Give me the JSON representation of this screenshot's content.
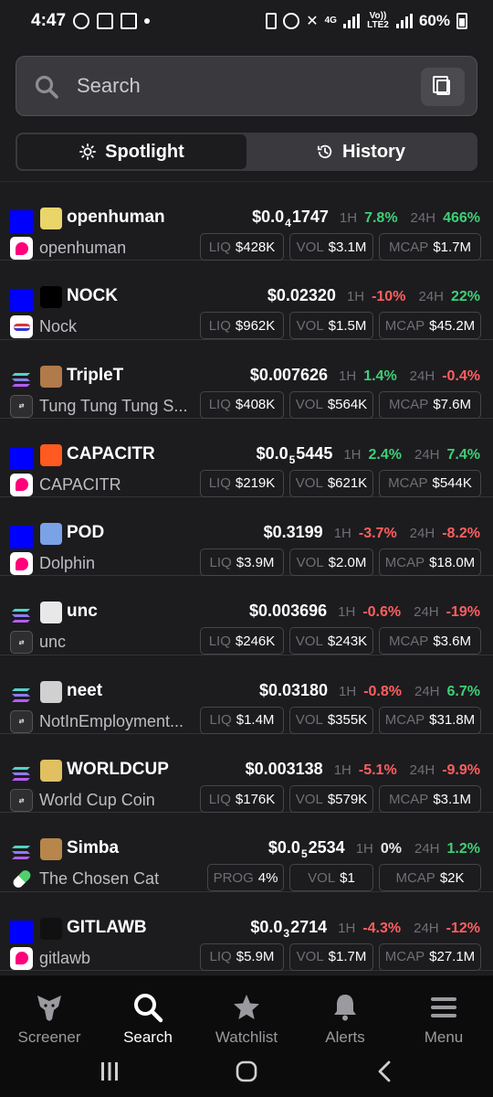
{
  "status_bar": {
    "time": "4:47",
    "network_4g": "4G",
    "volte": "Vo)) LTE2",
    "battery": "60%"
  },
  "search": {
    "placeholder": "Search",
    "value": ""
  },
  "tabs": [
    {
      "label": "Spotlight",
      "icon": "sun-icon",
      "active": true
    },
    {
      "label": "History",
      "icon": "history-icon",
      "active": false
    }
  ],
  "labels": {
    "h1": "1H",
    "h24": "24H",
    "liq": "LIQ",
    "vol": "VOL",
    "mcap": "MCAP",
    "prog": "PROG"
  },
  "tokens": [
    {
      "symbol": "openhuman",
      "name": "openhuman",
      "chain": "blue",
      "dex": "uniswap",
      "price_pre": "$0.0",
      "price_sub": "4",
      "price_post": "1747",
      "h1": "7.8%",
      "h1_dir": "pos",
      "h24": "466%",
      "h24_dir": "pos",
      "liq": "$428K",
      "vol": "$3.1M",
      "mcap": "$1.7M"
    },
    {
      "symbol": "NOCK",
      "name": "Nock",
      "chain": "blue",
      "dex": "nock",
      "price_pre": "$0.02320",
      "price_sub": "",
      "price_post": "",
      "h1": "-10%",
      "h1_dir": "neg",
      "h24": "22%",
      "h24_dir": "pos",
      "liq": "$962K",
      "vol": "$1.5M",
      "mcap": "$45.2M"
    },
    {
      "symbol": "TripleT",
      "name": "Tung Tung Tung S...",
      "chain": "solana",
      "dex": "swap",
      "price_pre": "$0.007626",
      "price_sub": "",
      "price_post": "",
      "h1": "1.4%",
      "h1_dir": "pos",
      "h24": "-0.4%",
      "h24_dir": "neg",
      "liq": "$408K",
      "vol": "$564K",
      "mcap": "$7.6M"
    },
    {
      "symbol": "CAPACITR",
      "name": "CAPACITR",
      "chain": "blue",
      "dex": "uniswap",
      "price_pre": "$0.0",
      "price_sub": "5",
      "price_post": "5445",
      "h1": "2.4%",
      "h1_dir": "pos",
      "h24": "7.4%",
      "h24_dir": "pos",
      "liq": "$219K",
      "vol": "$621K",
      "mcap": "$544K"
    },
    {
      "symbol": "POD",
      "name": "Dolphin",
      "chain": "blue",
      "dex": "uniswap",
      "price_pre": "$0.3199",
      "price_sub": "",
      "price_post": "",
      "h1": "-3.7%",
      "h1_dir": "neg",
      "h24": "-8.2%",
      "h24_dir": "neg",
      "liq": "$3.9M",
      "vol": "$2.0M",
      "mcap": "$18.0M"
    },
    {
      "symbol": "unc",
      "name": "unc",
      "chain": "solana",
      "dex": "swap",
      "price_pre": "$0.003696",
      "price_sub": "",
      "price_post": "",
      "h1": "-0.6%",
      "h1_dir": "neg",
      "h24": "-19%",
      "h24_dir": "neg",
      "liq": "$246K",
      "vol": "$243K",
      "mcap": "$3.6M"
    },
    {
      "symbol": "neet",
      "name": "NotInEmployment...",
      "chain": "solana",
      "dex": "swap",
      "price_pre": "$0.03180",
      "price_sub": "",
      "price_post": "",
      "h1": "-0.8%",
      "h1_dir": "neg",
      "h24": "6.7%",
      "h24_dir": "pos",
      "liq": "$1.4M",
      "vol": "$355K",
      "mcap": "$31.8M"
    },
    {
      "symbol": "WORLDCUP",
      "name": "World Cup Coin",
      "chain": "solana",
      "dex": "swap",
      "price_pre": "$0.003138",
      "price_sub": "",
      "price_post": "",
      "h1": "-5.1%",
      "h1_dir": "neg",
      "h24": "-9.9%",
      "h24_dir": "neg",
      "liq": "$176K",
      "vol": "$579K",
      "mcap": "$3.1M"
    },
    {
      "symbol": "Simba",
      "name": "The Chosen Cat",
      "chain": "solana",
      "dex": "pump",
      "price_pre": "$0.0",
      "price_sub": "5",
      "price_post": "2534",
      "h1": "0%",
      "h1_dir": "zero",
      "h24": "1.2%",
      "h24_dir": "pos",
      "prog": "4%",
      "vol": "$1",
      "mcap": "$2K"
    },
    {
      "symbol": "GITLAWB",
      "name": "gitlawb",
      "chain": "blue",
      "dex": "uniswap",
      "price_pre": "$0.0",
      "price_sub": "3",
      "price_post": "2714",
      "h1": "-4.3%",
      "h1_dir": "neg",
      "h24": "-12%",
      "h24_dir": "neg",
      "liq": "$5.9M",
      "vol": "$1.7M",
      "mcap": "$27.1M"
    }
  ],
  "bottom_nav": [
    {
      "label": "Screener",
      "icon": "eagle-icon",
      "active": false
    },
    {
      "label": "Search",
      "icon": "search-icon",
      "active": true
    },
    {
      "label": "Watchlist",
      "icon": "star-icon",
      "active": false
    },
    {
      "label": "Alerts",
      "icon": "bell-icon",
      "active": false
    },
    {
      "label": "Menu",
      "icon": "menu-icon",
      "active": false
    }
  ],
  "colors": {
    "background": "#1c1c1f",
    "positive": "#3fcf76",
    "negative": "#ff5f5f",
    "chain_blue": "#0000ff",
    "uniswap_pink": "#ff007a"
  }
}
